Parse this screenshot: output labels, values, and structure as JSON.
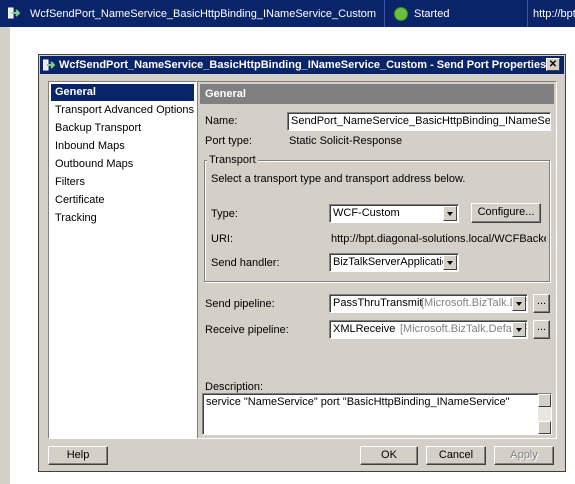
{
  "background_row": {
    "name": "WcfSendPort_NameService_BasicHttpBinding_INameService_Custom",
    "status": "Started",
    "address": "http://bpt."
  },
  "dialog": {
    "title": "WcfSendPort_NameService_BasicHttpBinding_INameService_Custom - Send Port Properties",
    "nav_items": [
      "General",
      "Transport Advanced Options",
      "Backup Transport",
      "Inbound Maps",
      "Outbound Maps",
      "Filters",
      "Certificate",
      "Tracking"
    ],
    "selected_nav": "General",
    "header": "General",
    "name_label": "Name:",
    "name_value": "SendPort_NameService_BasicHttpBinding_INameService_Custom",
    "port_type_label": "Port type:",
    "port_type_value": "Static Solicit-Response",
    "transport": {
      "group_label": "Transport",
      "instruction": "Select a transport type and transport address below.",
      "type_label": "Type:",
      "type_value": "WCF-Custom",
      "configure_label": "Configure...",
      "uri_label": "URI:",
      "uri_value": "http://bpt.diagonal-solutions.local/WCFBackendSystem",
      "handler_label": "Send handler:",
      "handler_value": "BizTalkServerApplication"
    },
    "send_pipeline_label": "Send pipeline:",
    "send_pipeline_value": "PassThruTransmit",
    "send_pipeline_assembly": "[Microsoft.BizTalk.Defau",
    "receive_pipeline_label": "Receive pipeline:",
    "receive_pipeline_value": "XMLReceive",
    "receive_pipeline_assembly": "[Microsoft.BizTalk.DefaultPip",
    "ellipsis": "...",
    "description_label": "Description:",
    "description_value": "service \"NameService\" port \"BasicHttpBinding_INameService\"",
    "buttons": {
      "help": "Help",
      "ok": "OK",
      "cancel": "Cancel",
      "apply": "Apply"
    },
    "close": "✕"
  }
}
